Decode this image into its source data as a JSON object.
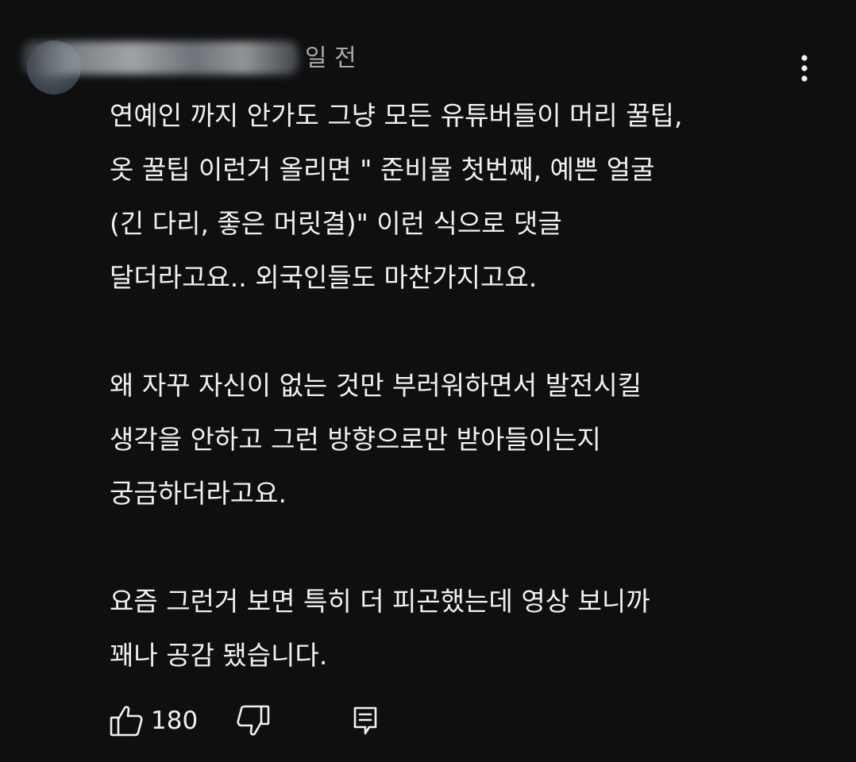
{
  "comment": {
    "timestamp": "일 전",
    "text": "연예인 까지 안가도 그냥 모든 유튜버들이 머리 꿀팁,\n옷 꿀팁 이런거 올리면 \" 준비물 첫번째, 예쁜 얼굴\n(긴 다리, 좋은 머릿결)\" 이런 식으로 댓글\n달더라고요.. 외국인들도 마찬가지고요.\n\n왜 자꾸 자신이 없는 것만 부러워하면서 발전시킬\n생각을 안하고 그런 방향으로만 받아들이는지\n궁금하더라고요.\n\n요즘 그런거 보면 특히 더 피곤했는데 영상 보니까\n꽤나 공감 됐습니다.",
    "like_count": "180"
  },
  "icons": {
    "like": "thumbs-up-icon",
    "dislike": "thumbs-down-icon",
    "reply": "reply-comment-icon",
    "more": "more-vertical-icon"
  },
  "colors": {
    "background": "#0f0f0f",
    "text_primary": "#f1f1f1",
    "text_secondary": "#aaaaaa"
  }
}
